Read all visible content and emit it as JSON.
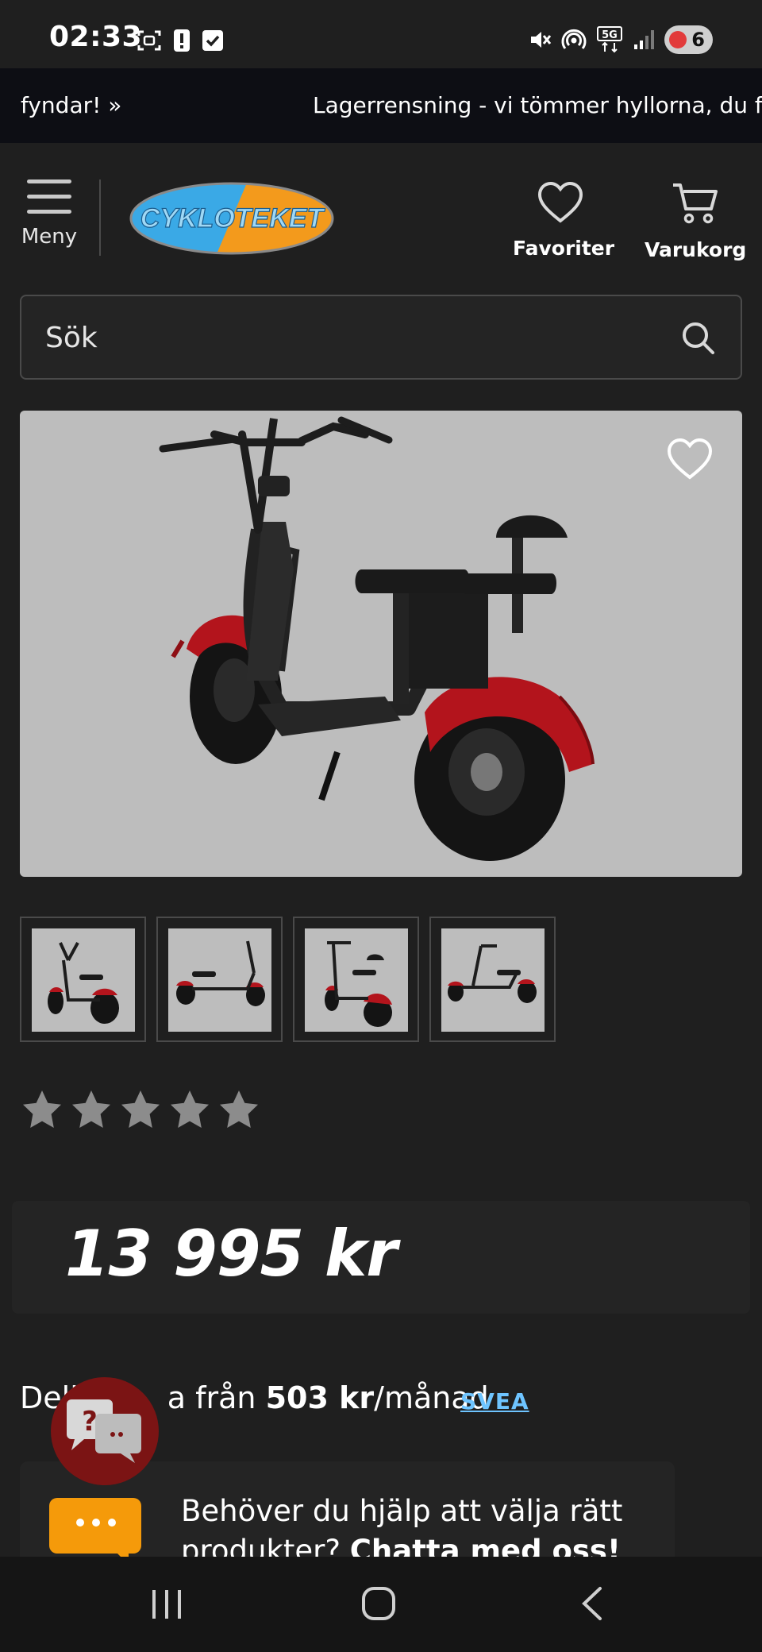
{
  "status_bar": {
    "time": "02:33",
    "network": "5G",
    "battery": "6",
    "icons_left": [
      "screenshot-icon",
      "alert-icon",
      "check-icon"
    ],
    "icons_right": [
      "mute-icon",
      "hotspot-icon",
      "5g-icon",
      "signal-icon",
      "battery-icon"
    ]
  },
  "announcement": {
    "left_text": "fyndar! »",
    "right_text": "Lagerrensning - vi tömmer hyllorna, du fyn"
  },
  "header": {
    "menu_label": "Meny",
    "logo_text": "CYKLOTEKET",
    "favorites_label": "Favoriter",
    "cart_label": "Varukorg"
  },
  "search": {
    "placeholder": "Sök"
  },
  "product": {
    "thumbnail_count": 4,
    "rating": {
      "filled": 0,
      "max": 5
    },
    "price": "13 995 kr"
  },
  "installment": {
    "prefix_visible": "Deli",
    "middle_visible": "a från ",
    "amount": "503 kr",
    "suffix": "/månad",
    "provider": "SVEA"
  },
  "chat": {
    "text_line1": "Behöver du hjälp att välja rätt",
    "text_line2_plain": "produkter? ",
    "text_line2_bold": "Chatta med oss!"
  },
  "help_bubble": {
    "symbol": "?"
  },
  "colors": {
    "background": "#1f1f1f",
    "announcement_bg": "#0d0e14",
    "accent_orange": "#f59a0a",
    "logo_blue": "#3aa9e6",
    "logo_orange": "#f39a1c",
    "help_red": "#7b1414",
    "scooter_red": "#b3141c"
  }
}
